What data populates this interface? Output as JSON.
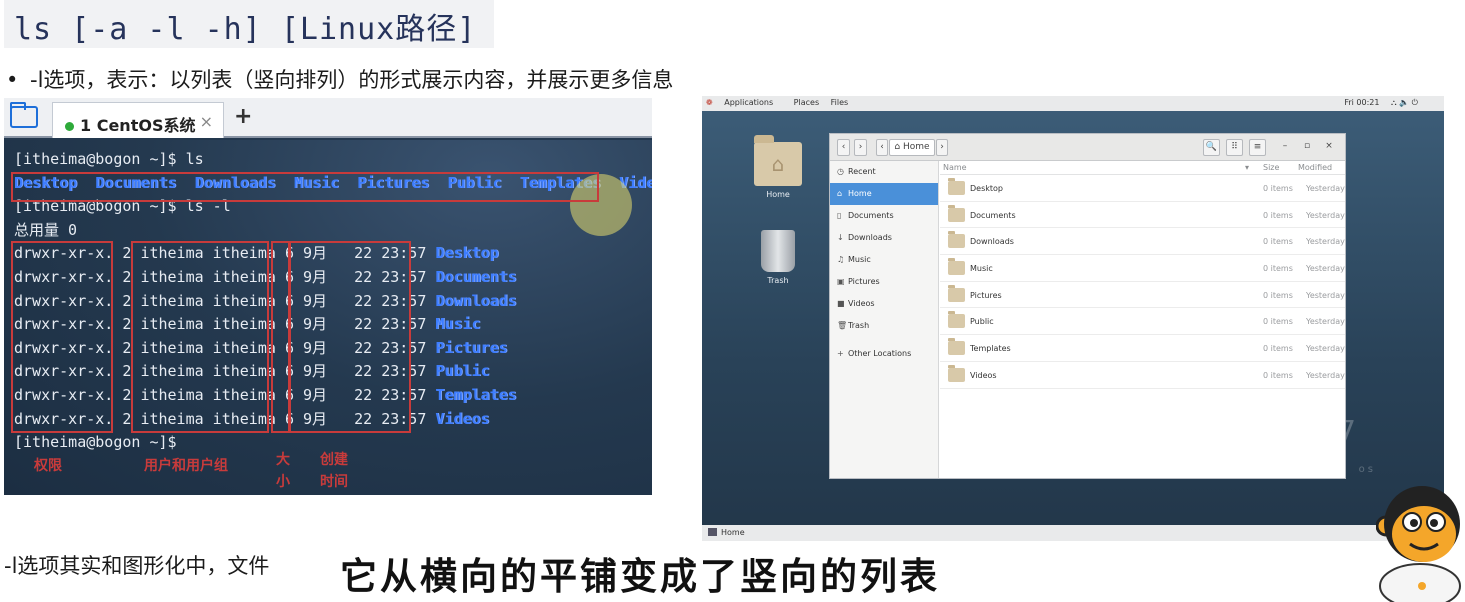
{
  "slide": {
    "command": "ls [-a -l -h] [Linux路径]",
    "bullet": "-l选项，表示：以列表（竖向排列）的形式展示内容，并展示更多信息",
    "bottom_text": "-l选项其实和图形化中，文件",
    "subtitle": "它从横向的平铺变成了竖向的列表"
  },
  "terminal": {
    "tab_label": "1 CentOS系统",
    "tab_close": "×",
    "new_tab": "+",
    "lines": {
      "l1": "[itheima@bogon ~]$ ls",
      "ls_dirs": [
        "Desktop",
        "Documents",
        "Downloads",
        "Music",
        "Pictures",
        "Public",
        "Templates",
        "Videos"
      ],
      "l3": "[itheima@bogon ~]$ ls -l",
      "l4": "总用量 0",
      "last": "[itheima@bogon ~]$ "
    },
    "rows": [
      {
        "perm": "drwxr-xr-x.",
        "links": "2",
        "owner": "itheima itheima",
        "size": "6",
        "date": "9月   22 23:57",
        "name": "Desktop"
      },
      {
        "perm": "drwxr-xr-x.",
        "links": "2",
        "owner": "itheima itheima",
        "size": "6",
        "date": "9月   22 23:57",
        "name": "Documents"
      },
      {
        "perm": "drwxr-xr-x.",
        "links": "2",
        "owner": "itheima itheima",
        "size": "6",
        "date": "9月   22 23:57",
        "name": "Downloads"
      },
      {
        "perm": "drwxr-xr-x.",
        "links": "2",
        "owner": "itheima itheima",
        "size": "6",
        "date": "9月   22 23:57",
        "name": "Music"
      },
      {
        "perm": "drwxr-xr-x.",
        "links": "2",
        "owner": "itheima itheima",
        "size": "6",
        "date": "9月   22 23:57",
        "name": "Pictures"
      },
      {
        "perm": "drwxr-xr-x.",
        "links": "2",
        "owner": "itheima itheima",
        "size": "6",
        "date": "9月   22 23:57",
        "name": "Public"
      },
      {
        "perm": "drwxr-xr-x.",
        "links": "2",
        "owner": "itheima itheima",
        "size": "6",
        "date": "9月   22 23:57",
        "name": "Templates"
      },
      {
        "perm": "drwxr-xr-x.",
        "links": "2",
        "owner": "itheima itheima",
        "size": "6",
        "date": "9月   22 23:57",
        "name": "Videos"
      }
    ],
    "labels": {
      "perm": "权限",
      "owner": "用户和用户组",
      "size_1": "大",
      "size_2": "小",
      "created_1": "创建",
      "created_2": "时间"
    },
    "colors": {
      "dir": "#3d7dff",
      "annotation": "#c83b3b"
    }
  },
  "desktop": {
    "topbar": {
      "applications": "Applications",
      "places": "Places",
      "files": "Files",
      "clock": "Fri 00:21",
      "status_icons": "⛬ 🔈 ⏻"
    },
    "icons": {
      "home": "Home",
      "trash": "Trash"
    },
    "taskbar": "Home",
    "deco_7": "7",
    "deco_os": "os",
    "file_manager": {
      "path": "Home",
      "nav": {
        "back": "‹",
        "forward": "›",
        "left": "‹",
        "right": "›"
      },
      "buttons": {
        "search": "🔍",
        "view_grid": "⠿",
        "view_list": "≡",
        "minimize": "–",
        "maximize": "▫",
        "close": "×"
      },
      "sidebar": [
        {
          "icon": "◷",
          "label": "Recent"
        },
        {
          "icon": "⌂",
          "label": "Home"
        },
        {
          "icon": "▯",
          "label": "Documents"
        },
        {
          "icon": "↓",
          "label": "Downloads"
        },
        {
          "icon": "♫",
          "label": "Music"
        },
        {
          "icon": "▣",
          "label": "Pictures"
        },
        {
          "icon": "■",
          "label": "Videos"
        },
        {
          "icon": "🗑",
          "label": "Trash"
        },
        {
          "icon": "+",
          "label": "Other Locations"
        }
      ],
      "columns": {
        "name": "Name",
        "sort": "▾",
        "size": "Size",
        "modified": "Modified"
      },
      "files": [
        {
          "name": "Desktop",
          "size": "0 items",
          "modified": "Yesterday"
        },
        {
          "name": "Documents",
          "size": "0 items",
          "modified": "Yesterday"
        },
        {
          "name": "Downloads",
          "size": "0 items",
          "modified": "Yesterday"
        },
        {
          "name": "Music",
          "size": "0 items",
          "modified": "Yesterday"
        },
        {
          "name": "Pictures",
          "size": "0 items",
          "modified": "Yesterday"
        },
        {
          "name": "Public",
          "size": "0 items",
          "modified": "Yesterday"
        },
        {
          "name": "Templates",
          "size": "0 items",
          "modified": "Yesterday"
        },
        {
          "name": "Videos",
          "size": "0 items",
          "modified": "Yesterday"
        }
      ]
    }
  }
}
